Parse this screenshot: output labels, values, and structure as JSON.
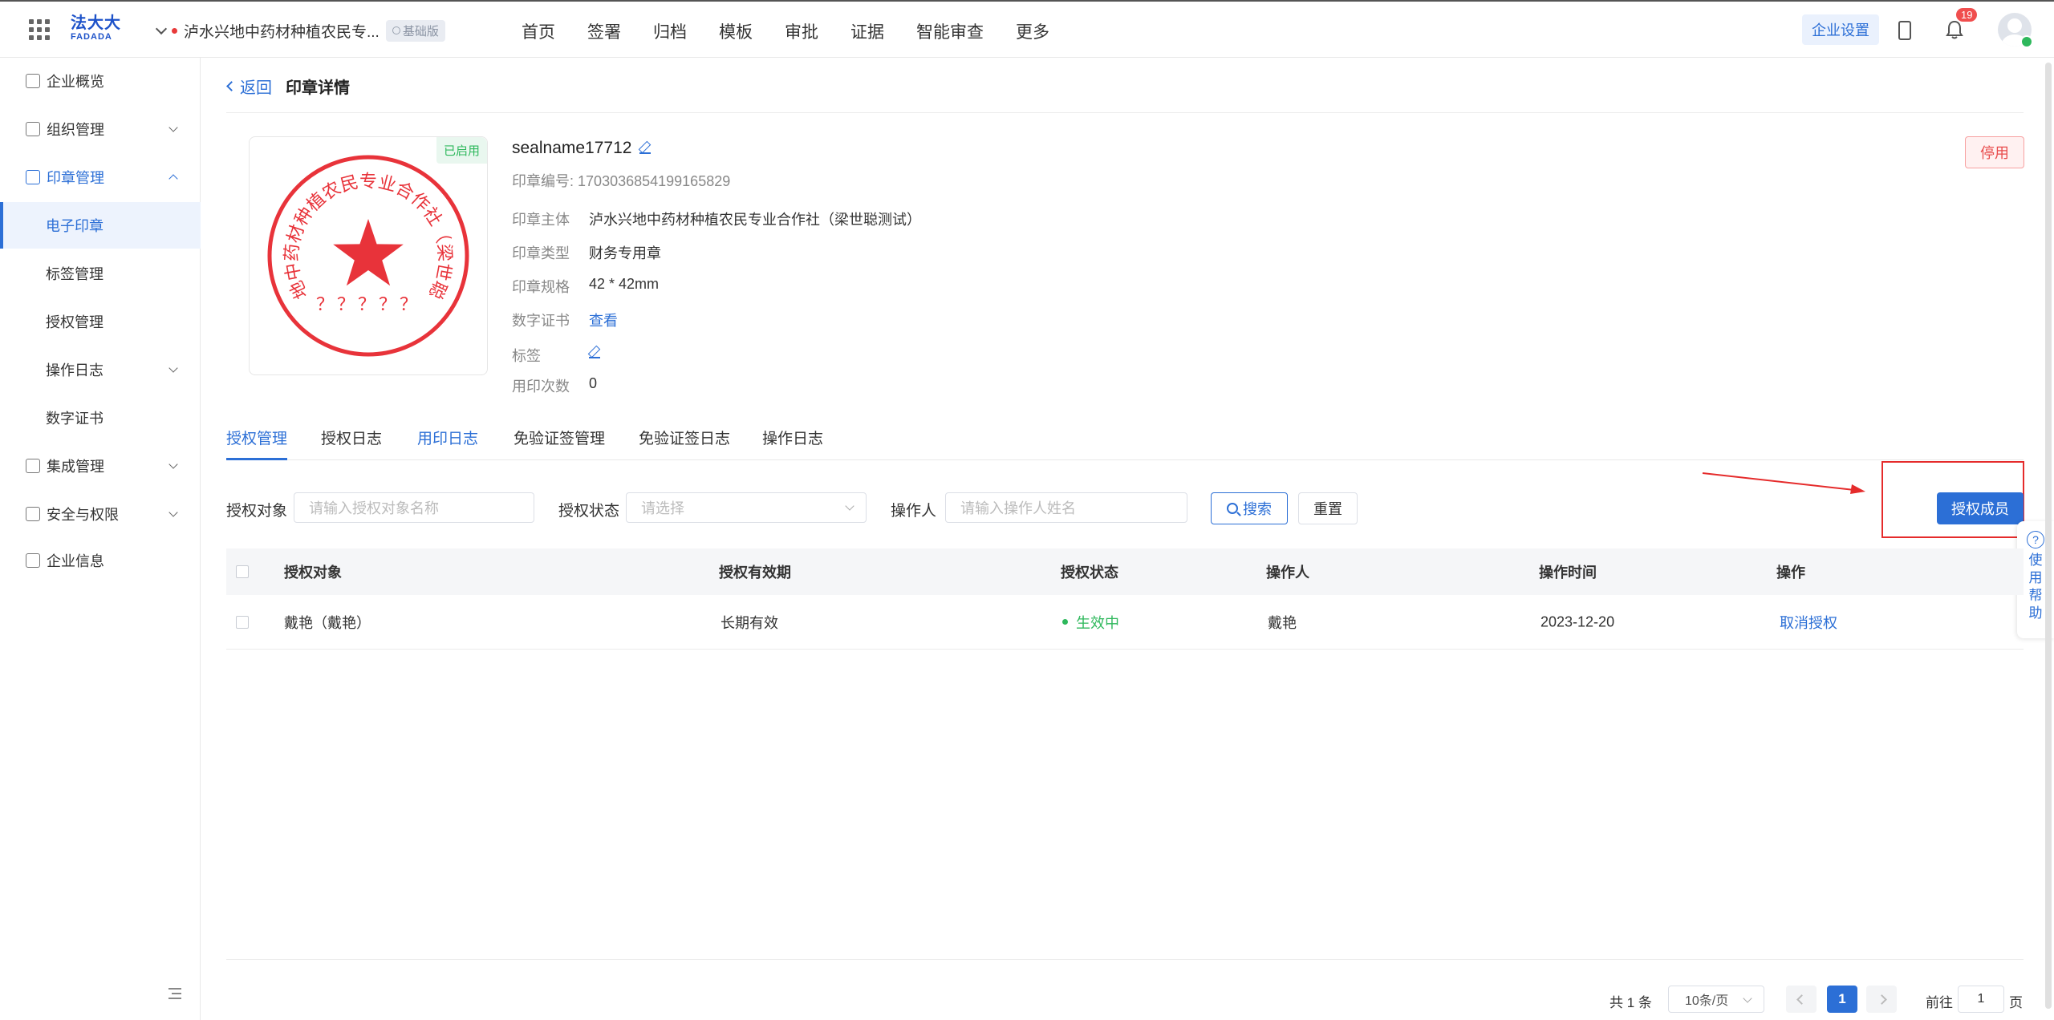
{
  "header": {
    "logo_cn": "法大大",
    "logo_en": "FADADA",
    "company": "泸水兴地中药材种植农民专...",
    "plan_badge": "基础版",
    "nav": [
      "首页",
      "签署",
      "归档",
      "模板",
      "审批",
      "证据",
      "智能审查",
      "更多"
    ],
    "settings_label": "企业设置",
    "notification_count": "19"
  },
  "sidebar": {
    "items": [
      {
        "label": "企业概览"
      },
      {
        "label": "组织管理"
      },
      {
        "label": "印章管理"
      },
      {
        "label": "电子印章"
      },
      {
        "label": "标签管理"
      },
      {
        "label": "授权管理"
      },
      {
        "label": "操作日志"
      },
      {
        "label": "数字证书"
      },
      {
        "label": "集成管理"
      },
      {
        "label": "安全与权限"
      },
      {
        "label": "企业信息"
      }
    ]
  },
  "page": {
    "back_label": "返回",
    "title": "印章详情"
  },
  "seal": {
    "status": "已启用",
    "name": "sealname17712",
    "number_label": "印章编号:",
    "number": "1703036854199165829",
    "ring_text": "泸水兴地中药材种植农民专业合作社（梁世聪测试）",
    "bottom_text": "？？？？？",
    "fields": [
      {
        "key": "印章主体",
        "value": "泸水兴地中药材种植农民专业合作社（梁世聪测试）"
      },
      {
        "key": "印章类型",
        "value": "财务专用章"
      },
      {
        "key": "印章规格",
        "value": "42 * 42mm"
      },
      {
        "key": "数字证书",
        "value": "查看"
      },
      {
        "key": "标签",
        "value": ""
      },
      {
        "key": "用印次数",
        "value": "0"
      }
    ],
    "disable_label": "停用",
    "seal_color": "#e8333a"
  },
  "tabs": [
    "授权管理",
    "授权日志",
    "用印日志",
    "免验证签管理",
    "免验证签日志",
    "操作日志"
  ],
  "filters": {
    "target_label": "授权对象",
    "target_placeholder": "请输入授权对象名称",
    "status_label": "授权状态",
    "status_placeholder": "请选择",
    "operator_label": "操作人",
    "operator_placeholder": "请输入操作人姓名",
    "search_label": "搜索",
    "reset_label": "重置",
    "authorize_label": "授权成员"
  },
  "table": {
    "columns": [
      "授权对象",
      "授权有效期",
      "授权状态",
      "操作人",
      "操作时间",
      "操作"
    ],
    "rows": [
      {
        "target": "戴艳（戴艳）",
        "validity": "长期有效",
        "status": "生效中",
        "operator": "戴艳",
        "time": "2023-12-20",
        "action": "取消授权"
      }
    ]
  },
  "help": {
    "label": "使用帮助"
  },
  "pagination": {
    "total": "共 1 条",
    "page_size": "10条/页",
    "current": "1",
    "goto_prefix": "前往",
    "goto_value": "1",
    "goto_suffix": "页"
  },
  "colors": {
    "accent": "#2c6fd6",
    "success": "#2eb85c",
    "danger": "#e52b2b"
  }
}
